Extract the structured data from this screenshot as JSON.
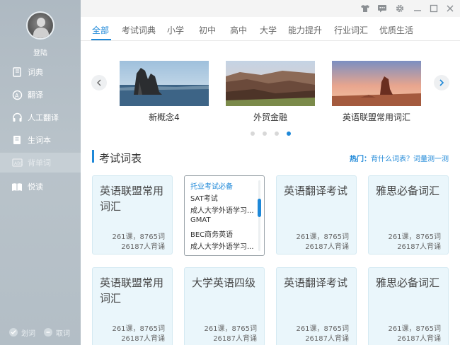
{
  "sidebar": {
    "login_label": "登陆",
    "items": [
      {
        "label": "词典",
        "icon": "book-icon"
      },
      {
        "label": "翻译",
        "icon": "translate-icon"
      },
      {
        "label": "人工翻译",
        "icon": "headset-icon"
      },
      {
        "label": "生词本",
        "icon": "notebook-icon"
      },
      {
        "label": "背单词",
        "icon": "flashcard-icon"
      },
      {
        "label": "悦读",
        "icon": "reading-icon"
      }
    ],
    "active_item": "背单词",
    "bottom": {
      "left_label": "划词",
      "right_label": "取词"
    }
  },
  "titlebar": {
    "icons": [
      "shirt-icon",
      "chat-icon",
      "gear-icon",
      "minimize-icon",
      "maximize-icon",
      "close-icon"
    ]
  },
  "tabs": [
    "全部",
    "考试词典",
    "小学",
    "初中",
    "高中",
    "大学",
    "能力提升",
    "行业词汇",
    "优质生活"
  ],
  "active_tab": "全部",
  "carousel": {
    "slides": [
      {
        "title": "新概念4"
      },
      {
        "title": "外贸金融"
      },
      {
        "title": "英语联盟常用词汇"
      }
    ],
    "dot_count": 4,
    "active_dot": 4
  },
  "section": {
    "title": "考试词表",
    "hot_label": "热门：",
    "hot_links": "背什么词表？词量测一测"
  },
  "cards": [
    {
      "name": "英语联盟常用词汇",
      "stat1": "261课，8765词",
      "stat2": "26187人背诵"
    },
    {
      "name": "托业考试必备",
      "stat1": "",
      "stat2": ""
    },
    {
      "name": "英语翻译考试",
      "stat1": "261课，8765词",
      "stat2": "26187人背诵"
    },
    {
      "name": "雅思必备词汇",
      "stat1": "261课，8765词",
      "stat2": "26187人背诵"
    },
    {
      "name": "英语联盟常用词汇",
      "stat1": "261课，8765词",
      "stat2": "26187人背诵"
    },
    {
      "name": "大学英语四级",
      "stat1": "261课，8765词",
      "stat2": "26187人背诵"
    },
    {
      "name": "英语翻译考试",
      "stat1": "261课，8765词",
      "stat2": "26187人背诵"
    },
    {
      "name": "雅思必备词汇",
      "stat1": "261课，8765词",
      "stat2": "26187人背诵"
    }
  ],
  "dropdown": {
    "options": [
      "托业考试必备",
      "SAT考试",
      "成人大学外语学习...",
      "GMAT",
      "BEC商务英语",
      "成人大学外语学习..."
    ],
    "highlighted": "托业考试必备"
  },
  "colors": {
    "accent": "#1e88d8",
    "sidebar": "#b3bec6",
    "card_bg": "#eaf6fb"
  }
}
